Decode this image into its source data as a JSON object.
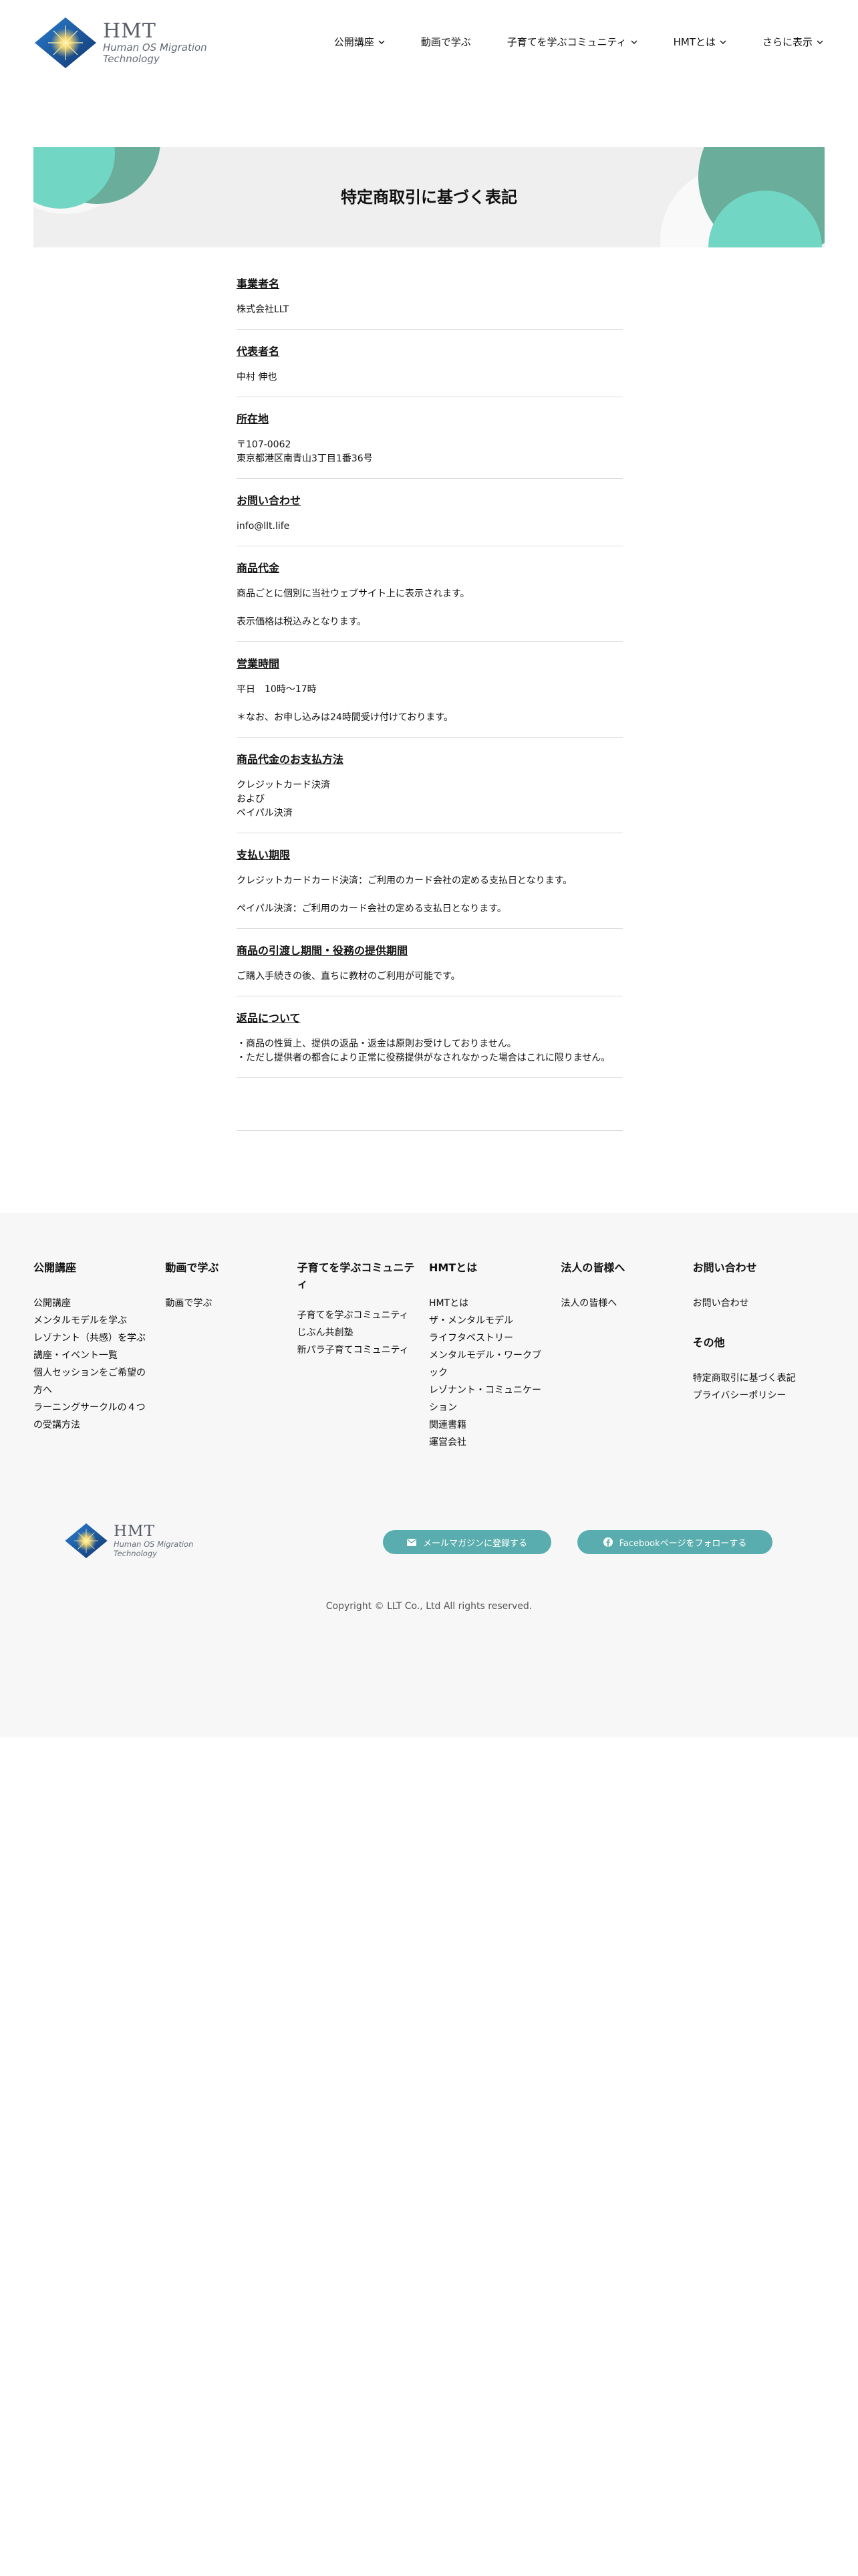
{
  "header": {
    "logo": {
      "name": "HMT",
      "sub1": "Human OS Migration",
      "sub2": "Technology"
    },
    "nav": [
      {
        "label": "公開講座",
        "has_menu": true
      },
      {
        "label": "動画で学ぶ",
        "has_menu": false
      },
      {
        "label": "子育てを学ぶコミュニティ",
        "has_menu": true
      },
      {
        "label": "HMTとは",
        "has_menu": true
      },
      {
        "label": "さらに表示",
        "has_menu": true
      }
    ]
  },
  "page": {
    "title": "特定商取引に基づく表記"
  },
  "sections": [
    {
      "label": "事業者名",
      "lines": [
        "株式会社LLT"
      ]
    },
    {
      "label": "代表者名",
      "lines": [
        "中村 伸也"
      ]
    },
    {
      "label": "所在地",
      "lines": [
        "〒107-0062",
        "東京都港区南青山3丁目1番36号"
      ]
    },
    {
      "label": "お問い合わせ",
      "lines": [
        "info@llt.life"
      ]
    },
    {
      "label": "商品代金",
      "lines": [
        "商品ごとに個別に当社ウェブサイト上に表示されます。",
        "",
        "表示価格は税込みとなります。"
      ]
    },
    {
      "label": "営業時間",
      "lines": [
        "平日　10時〜17時",
        "",
        "＊なお、お申し込みは24時間受け付けております。"
      ]
    },
    {
      "label": "商品代金のお支払方法",
      "lines": [
        "クレジットカード決済",
        "および",
        "ペイパル決済"
      ]
    },
    {
      "label": "支払い期限",
      "lines": [
        "クレジットカードカード決済：ご利用のカード会社の定める支払日となります。",
        "",
        "ペイパル決済：ご利用のカード会社の定める支払日となります。"
      ]
    },
    {
      "label": "商品の引渡し期間・役務の提供期間",
      "lines": [
        "ご購入手続きの後、直ちに教材のご利用が可能です。"
      ]
    },
    {
      "label": "返品について",
      "lines": [
        "・商品の性質上、提供の返品・返金は原則お受けしておりません。",
        "・ただし提供者の都合により正常に役務提供がなされなかった場合はこれに限りません。"
      ]
    }
  ],
  "footer": {
    "columns": [
      {
        "heading": "公開講座",
        "links": [
          "公開講座",
          "メンタルモデルを学ぶ",
          "レゾナント（共感）を学ぶ",
          "講座・イベント一覧",
          "個人セッションをご希望の",
          "方へ",
          "ラーニングサークルの４つ",
          "の受講方法"
        ]
      },
      {
        "heading": "動画で学ぶ",
        "links": [
          "動画で学ぶ"
        ]
      },
      {
        "heading": "子育てを学ぶコミュニテ",
        "heading2": "ィ",
        "links": [
          "子育てを学ぶコミュニティ",
          "じぶん共創塾",
          "新パラ子育てコミュニティ"
        ]
      },
      {
        "heading": "HMTとは",
        "links": [
          "HMTとは",
          "ザ・メンタルモデル",
          "ライフタペストリー",
          "メンタルモデル・ワークブ",
          "ック",
          "レゾナント・コミュニケー",
          "ション",
          "関連書籍",
          "運営会社"
        ]
      },
      {
        "heading": "法人の皆様へ",
        "links": [
          "法人の皆様へ"
        ]
      },
      {
        "heading": "お問い合わせ",
        "links": [
          "お問い合わせ"
        ],
        "heading_b": "その他",
        "links_b": [
          "特定商取引に基づく表記",
          "プライバシーポリシー"
        ]
      }
    ],
    "newsletter_button": "メールマガジンに登録する",
    "facebook_button": "Facebookページをフォローする",
    "copyright": "Copyright © LLT Co., Ltd All rights reserved."
  },
  "colors": {
    "teal": "#5aadae",
    "mint": "#6dd9c6",
    "footer_bg": "#f7f7f7",
    "banner_bg": "#efefef"
  }
}
